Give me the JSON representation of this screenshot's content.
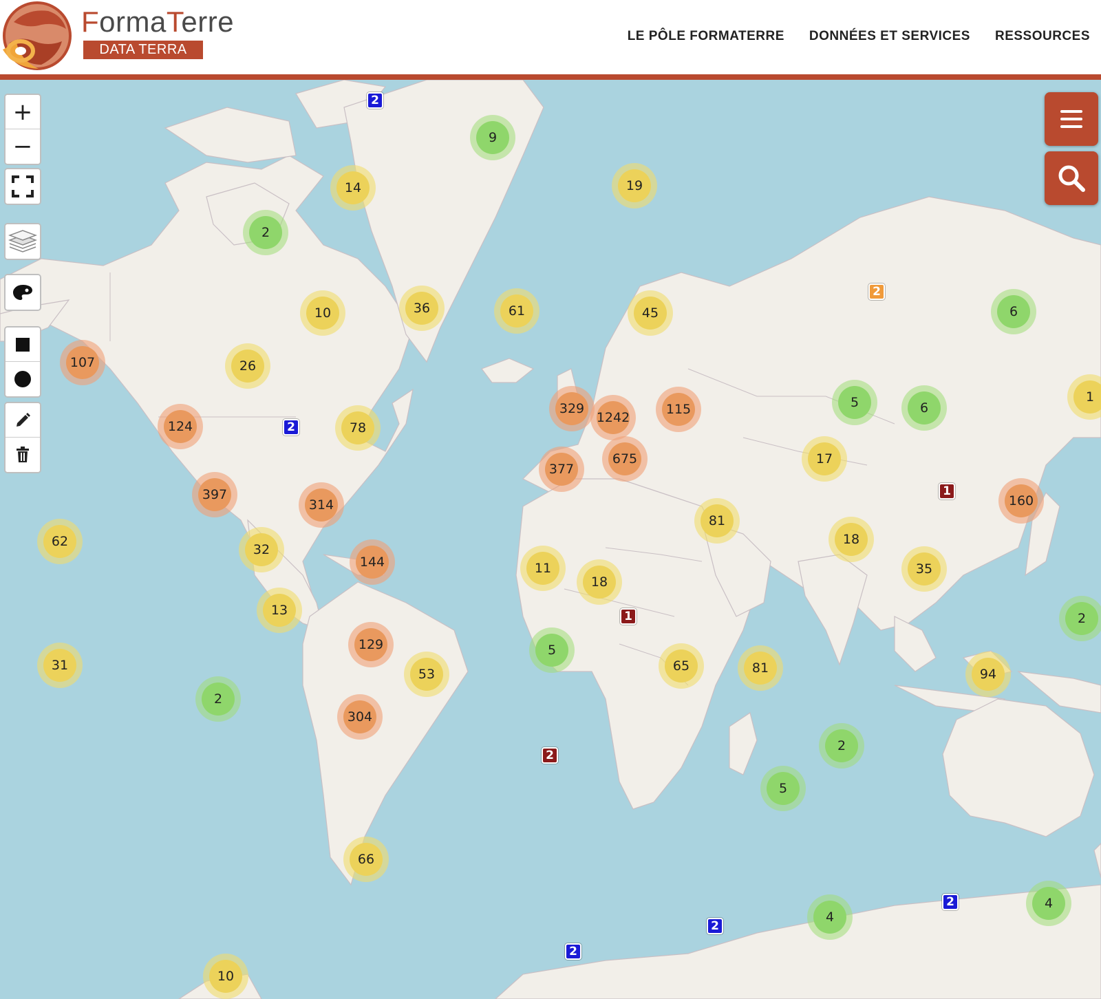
{
  "header": {
    "brand_title_first": "F",
    "brand_title_middle": "orma",
    "brand_title_accent": "T",
    "brand_title_end": "erre",
    "brand_subtitle": "DATA TERRA",
    "nav": [
      "LE PÔLE FORMATERRE",
      "DONNÉES ET SERVICES",
      "RESSOURCES"
    ]
  },
  "colors": {
    "brand": "#b94a2f",
    "water": "#aad3df",
    "land": "#f2efe9",
    "cluster_small": "#8fd66b",
    "cluster_medium": "#ecd25a",
    "cluster_large": "#e9995e",
    "marker_blue": "#1a1ad6",
    "marker_red": "#8b1a1a",
    "marker_orange": "#f09a3a"
  },
  "map_controls": {
    "zoom_in": "+",
    "zoom_out": "−"
  },
  "clusters": [
    {
      "label": "9",
      "cls": "green"
    },
    {
      "label": "14",
      "cls": "yellow"
    },
    {
      "label": "19",
      "cls": "yellow"
    },
    {
      "label": "2",
      "cls": "green"
    },
    {
      "label": "10",
      "cls": "yellow"
    },
    {
      "label": "36",
      "cls": "yellow"
    },
    {
      "label": "61",
      "cls": "yellow"
    },
    {
      "label": "45",
      "cls": "yellow"
    },
    {
      "label": "6",
      "cls": "green"
    },
    {
      "label": "107",
      "cls": "orange"
    },
    {
      "label": "26",
      "cls": "yellow"
    },
    {
      "label": "5",
      "cls": "green"
    },
    {
      "label": "6",
      "cls": "green"
    },
    {
      "label": "1",
      "cls": "yellow"
    },
    {
      "label": "124",
      "cls": "orange"
    },
    {
      "label": "78",
      "cls": "yellow"
    },
    {
      "label": "329",
      "cls": "orange"
    },
    {
      "label": "1242",
      "cls": "orange"
    },
    {
      "label": "115",
      "cls": "orange"
    },
    {
      "label": "675",
      "cls": "orange"
    },
    {
      "label": "377",
      "cls": "orange"
    },
    {
      "label": "17",
      "cls": "yellow"
    },
    {
      "label": "160",
      "cls": "orange"
    },
    {
      "label": "397",
      "cls": "orange"
    },
    {
      "label": "314",
      "cls": "orange"
    },
    {
      "label": "81",
      "cls": "yellow"
    },
    {
      "label": "62",
      "cls": "yellow"
    },
    {
      "label": "32",
      "cls": "yellow"
    },
    {
      "label": "144",
      "cls": "orange"
    },
    {
      "label": "18",
      "cls": "yellow"
    },
    {
      "label": "11",
      "cls": "yellow"
    },
    {
      "label": "18",
      "cls": "yellow"
    },
    {
      "label": "35",
      "cls": "yellow"
    },
    {
      "label": "13",
      "cls": "yellow"
    },
    {
      "label": "2",
      "cls": "green"
    },
    {
      "label": "129",
      "cls": "orange"
    },
    {
      "label": "5",
      "cls": "green"
    },
    {
      "label": "65",
      "cls": "yellow"
    },
    {
      "label": "81",
      "cls": "yellow"
    },
    {
      "label": "31",
      "cls": "yellow"
    },
    {
      "label": "53",
      "cls": "yellow"
    },
    {
      "label": "94",
      "cls": "yellow"
    },
    {
      "label": "2",
      "cls": "green"
    },
    {
      "label": "304",
      "cls": "orange"
    },
    {
      "label": "2",
      "cls": "green"
    },
    {
      "label": "5",
      "cls": "green"
    },
    {
      "label": "66",
      "cls": "yellow"
    },
    {
      "label": "4",
      "cls": "green"
    },
    {
      "label": "4",
      "cls": "green"
    },
    {
      "label": "10",
      "cls": "yellow"
    }
  ],
  "markers": [
    {
      "label": "2",
      "color": "blue"
    },
    {
      "label": "2",
      "color": "orange"
    },
    {
      "label": "2",
      "color": "blue"
    },
    {
      "label": "1",
      "color": "red"
    },
    {
      "label": "1",
      "color": "red"
    },
    {
      "label": "2",
      "color": "red"
    },
    {
      "label": "2",
      "color": "blue"
    },
    {
      "label": "2",
      "color": "blue"
    },
    {
      "label": "2",
      "color": "blue"
    }
  ]
}
